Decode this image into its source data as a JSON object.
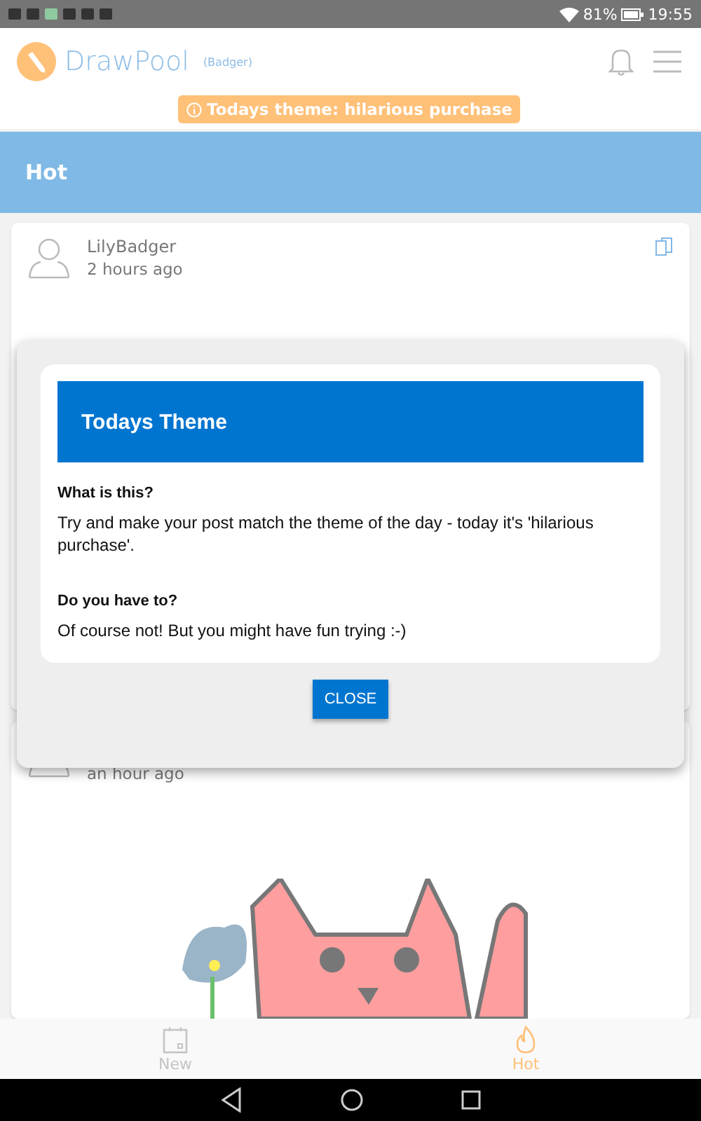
{
  "status_bar": {
    "battery": "81%",
    "time": "19:55"
  },
  "header": {
    "logo": "DrawPool",
    "user": "(Badger)",
    "theme_badge": "Todays theme: hilarious purchase"
  },
  "section": {
    "title": "Hot"
  },
  "posts": [
    {
      "author": "LilyBadger",
      "time": "2 hours ago"
    },
    {
      "time": "an hour ago",
      "kind": "picture"
    }
  ],
  "dialog": {
    "title": "Todays Theme",
    "sections": [
      {
        "heading": "What is this?",
        "text": "Try and make your post match the theme of the day - today it's 'hilarious purchase'."
      },
      {
        "heading": "Do you have to?",
        "text": "Of course not! But you might have fun trying :-)"
      }
    ],
    "button": "CLOSE"
  },
  "bottom_nav": [
    {
      "label": "New",
      "selected": false,
      "kind": "calendar"
    },
    {
      "label": "Hot",
      "selected": true,
      "kind": "flame"
    }
  ]
}
